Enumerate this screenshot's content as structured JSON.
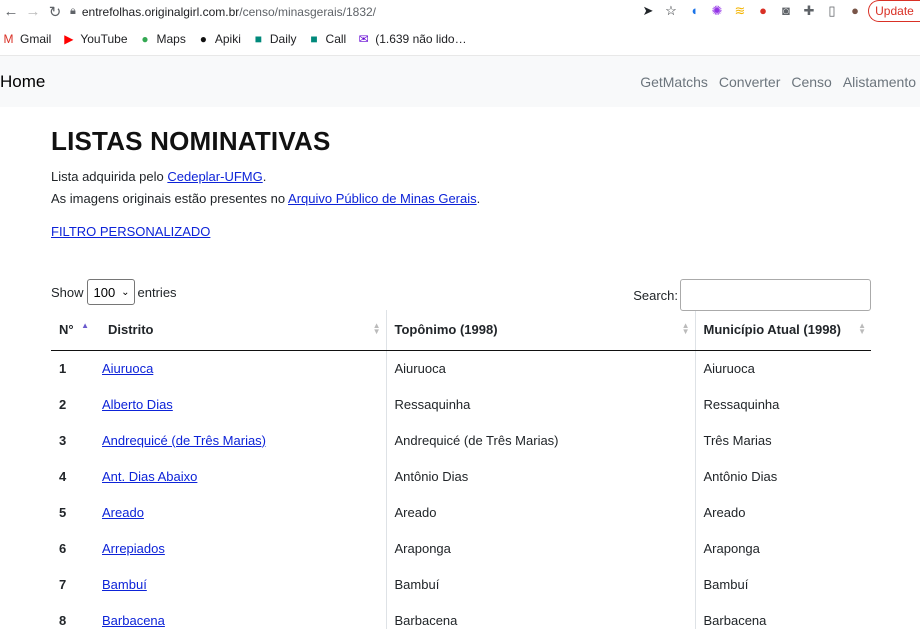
{
  "browser": {
    "url_host": "entrefolhas.originalgirl.com.br",
    "url_path": "/censo/minasgerais/1832/",
    "update_label": "Update",
    "bookmarks": [
      {
        "icon": "gmail-icon",
        "glyph": "M",
        "color": "#d93025",
        "label": "Gmail"
      },
      {
        "icon": "youtube-icon",
        "glyph": "▶",
        "color": "#ff0000",
        "label": "YouTube"
      },
      {
        "icon": "maps-icon",
        "glyph": "●",
        "color": "#34a853",
        "label": "Maps"
      },
      {
        "icon": "github-icon",
        "glyph": "●",
        "color": "#111111",
        "label": "Apiki"
      },
      {
        "icon": "meet-icon",
        "glyph": "■",
        "color": "#00897b",
        "label": "Daily"
      },
      {
        "icon": "meet-icon",
        "glyph": "■",
        "color": "#00897b",
        "label": "Call"
      },
      {
        "icon": "mail-icon",
        "glyph": "✉",
        "color": "#6001d2",
        "label": "(1.639 não lido…"
      }
    ]
  },
  "navbar": {
    "brand": "Home",
    "links": [
      "GetMatchs",
      "Converter",
      "Censo",
      "Alistamento"
    ]
  },
  "main": {
    "title": "LISTAS NOMINATIVAS",
    "line1_prefix": "Lista adquirida pelo ",
    "line1_link": "Cedeplar-UFMG",
    "line1_suffix": ".",
    "line2_prefix": "As imagens originais estão presentes no ",
    "line2_link": "Arquivo Público de Minas Gerais",
    "line2_suffix": ".",
    "filter_link": "FILTRO PERSONALIZADO"
  },
  "table_controls": {
    "show_label": "Show",
    "entries_value": "100",
    "entries_label": "entries",
    "search_label": "Search:"
  },
  "table": {
    "headers": [
      "N°",
      "Distrito",
      "Topônimo (1998)",
      "Município Atual (1998)"
    ],
    "rows": [
      [
        "1",
        "Aiuruoca",
        "Aiuruoca",
        "Aiuruoca"
      ],
      [
        "2",
        "Alberto Dias",
        "Ressaquinha",
        "Ressaquinha"
      ],
      [
        "3",
        "Andrequicé (de Três Marias)",
        "Andrequicé (de Três Marias)",
        "Três Marias"
      ],
      [
        "4",
        "Ant. Dias Abaixo",
        "Antônio Dias",
        "Antônio Dias"
      ],
      [
        "5",
        "Areado",
        "Areado",
        "Areado"
      ],
      [
        "6",
        "Arrepiados",
        "Araponga",
        "Araponga"
      ],
      [
        "7",
        "Bambuí",
        "Bambuí",
        "Bambuí"
      ],
      [
        "8",
        "Barbacena",
        "Barbacena",
        "Barbacena"
      ]
    ]
  }
}
